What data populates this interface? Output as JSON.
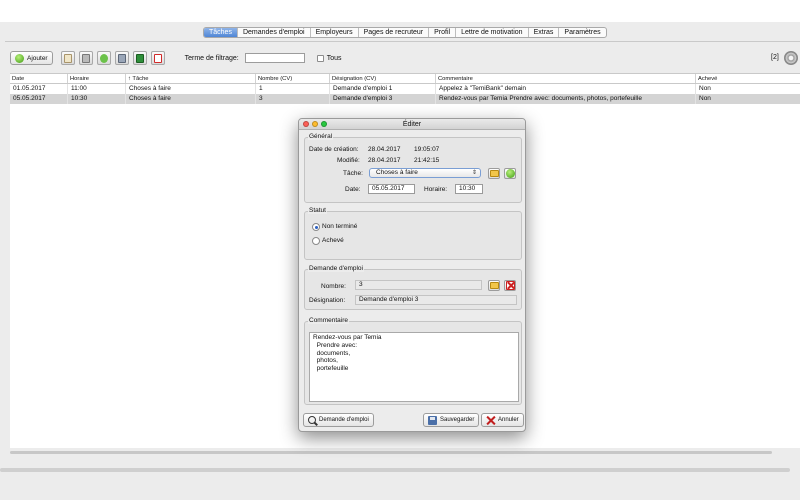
{
  "tabs": [
    {
      "label": "Tâches",
      "active": true
    },
    {
      "label": "Demandes d'emploi",
      "active": false
    },
    {
      "label": "Employeurs",
      "active": false
    },
    {
      "label": "Pages de recruteur",
      "active": false
    },
    {
      "label": "Profil",
      "active": false
    },
    {
      "label": "Lettre de motivation",
      "active": false
    },
    {
      "label": "Extras",
      "active": false
    },
    {
      "label": "Paramètres",
      "active": false
    }
  ],
  "toolbar": {
    "add_label": "Ajouter",
    "filter_label": "Terme de filtrage:",
    "filter_value": "",
    "all_label": "Tous",
    "count": "[2]"
  },
  "table": {
    "columns": [
      "Date",
      "Horaire",
      "↑ Tâche",
      "Nombre (CV)",
      "Désignation (CV)",
      "Commentaire",
      "Achevé"
    ],
    "rows": [
      [
        "01.05.2017",
        "11:00",
        "Choses à faire",
        "1",
        "Demande d'emploi 1",
        "Appelez à \"TemiBank\" demain",
        "Non"
      ],
      [
        "05.05.2017",
        "10:30",
        "Choses à faire",
        "3",
        "Demande d'emploi 3",
        "Rendez-vous par Temia   Prendre avec:   documents,   photos,   portefeuille",
        "Non"
      ]
    ]
  },
  "dialog": {
    "title": "Éditer",
    "general": {
      "legend": "Général",
      "created_label": "Date de création:",
      "created_date": "28.04.2017",
      "created_time": "19:05:07",
      "modified_label": "Modifié:",
      "modified_date": "28.04.2017",
      "modified_time": "21:42:15",
      "task_label": "Tâche:",
      "task_value": "Choses à faire",
      "date_label": "Date:",
      "date_value": "05.05.2017",
      "time_label": "Horaire:",
      "time_value": "10:30"
    },
    "status": {
      "legend": "Statut",
      "option_open": "Non terminé",
      "option_done": "Achevé"
    },
    "application": {
      "legend": "Demande d'emploi",
      "number_label": "Nombre:",
      "number_value": "3",
      "designation_label": "Désignation:",
      "designation_value": "Demande d'emploi 3"
    },
    "comment": {
      "legend": "Commentaire",
      "text": "Rendez-vous par Temia\n  Prendre avec:\n  documents,\n  photos,\n  portefeuille"
    },
    "buttons": {
      "application": "Demande d'emploi",
      "save": "Sauvegarder",
      "cancel": "Annuler"
    }
  },
  "colors": {
    "tab_active": "#4f86d6",
    "close_dot": "#fc5f57",
    "min_dot": "#fdbc2e",
    "max_dot": "#28c840"
  }
}
